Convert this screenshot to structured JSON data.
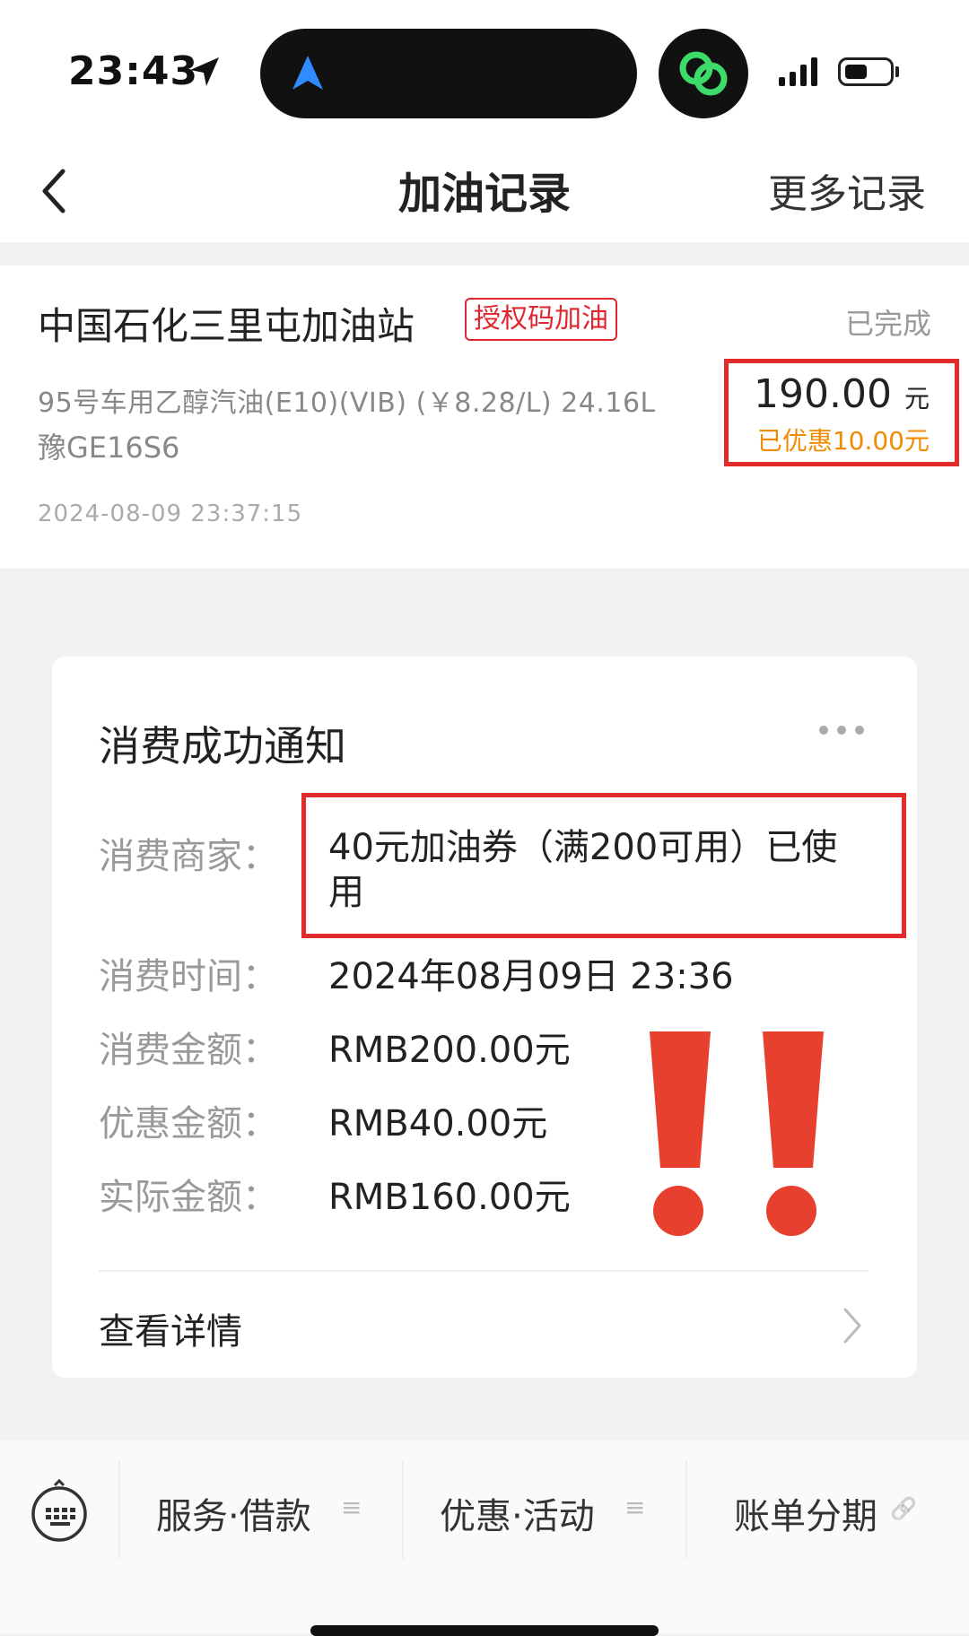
{
  "status_bar": {
    "time": "23:43"
  },
  "nav": {
    "title": "加油记录",
    "more": "更多记录"
  },
  "record": {
    "station": "中国石化三里屯加油站",
    "tag": "授权码加油",
    "status": "已完成",
    "fuel": "95号车用乙醇汽油(E10)(VIB) (￥8.28/L)  24.16L",
    "plate": "豫GE16S6",
    "datetime": "2024-08-09 23:37:15",
    "amount": "190.00",
    "amount_unit": "元",
    "discount": "已优惠10.00元"
  },
  "notice": {
    "title": "消费成功通知",
    "rows": [
      {
        "label": "消费商家：",
        "value": "40元加油券（满200可用）已使用"
      },
      {
        "label": "消费时间：",
        "value": "2024年08月09日 23:36"
      },
      {
        "label": "消费金额：",
        "value": "RMB200.00元"
      },
      {
        "label": "优惠金额：",
        "value": "RMB40.00元"
      },
      {
        "label": "实际金额：",
        "value": "RMB160.00元"
      }
    ],
    "detail": "查看详情"
  },
  "bottom_menu": {
    "items": [
      {
        "label": "服务·借款",
        "suffix": "≡"
      },
      {
        "label": "优惠·活动",
        "suffix": "≡"
      },
      {
        "label": "账单分期",
        "suffix": "🔗"
      }
    ]
  },
  "icons": {
    "back": "chevron-left-icon",
    "location": "location-arrow-icon",
    "keyboard": "keyboard-icon"
  },
  "colors": {
    "accent_red": "#e0262e",
    "discount_orange": "#f08a00",
    "exclaim_red": "#e8402f"
  }
}
